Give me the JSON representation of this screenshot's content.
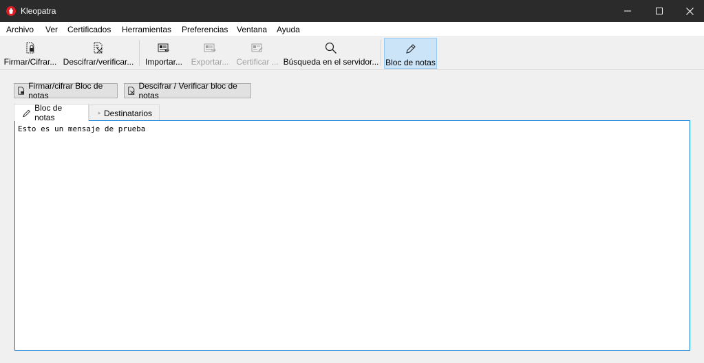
{
  "window": {
    "title": "Kleopatra",
    "accent": "#0078d7",
    "app_icon": "kleopatra-icon"
  },
  "menu": [
    "Archivo",
    "Ver",
    "Certificados",
    "Herramientas",
    "Preferencias",
    "Ventana",
    "Ayuda"
  ],
  "toolbar": {
    "sign_encrypt": "Firmar/Cifrar...",
    "decrypt_verify": "Descifrar/verificar...",
    "import": "Importar...",
    "export": "Exportar...",
    "certify": "Certificar ...",
    "lookup_server": "Búsqueda en el servidor...",
    "notepad": "Bloc de notas"
  },
  "actions": {
    "sign_encrypt_notepad": "Firmar/cifrar Bloc de notas",
    "decrypt_verify_notepad": "Descifrar / Verificar bloc de notas"
  },
  "tabs": {
    "notepad": "Bloc de notas",
    "recipients": "Destinatarios"
  },
  "editor": {
    "text": "Esto es un mensaje de prueba"
  }
}
